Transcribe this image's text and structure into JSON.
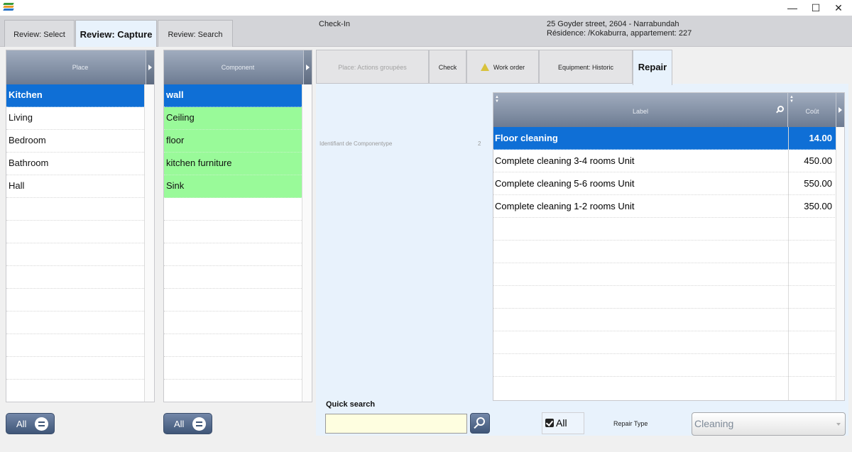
{
  "window": {
    "minimize": "—",
    "maximize": "☐",
    "close": "✕"
  },
  "header": {
    "tabs": [
      {
        "label": "Review: Select"
      },
      {
        "label": "Review: Capture"
      },
      {
        "label": "Review: Search"
      }
    ],
    "mode": "Check-In",
    "address_line1": "25 Goyder street, 2604 - Narrabundah",
    "address_line2": "Résidence: /Kokaburra, appartement: 227"
  },
  "place_panel": {
    "header": "Place",
    "items": [
      "Kitchen",
      "Living",
      "Bedroom",
      "Bathroom",
      "Hall"
    ],
    "selected_index": 0,
    "all_button": "All"
  },
  "component_panel": {
    "header": "Component",
    "items": [
      "wall",
      "Ceiling",
      "floor",
      "kitchen furniture",
      "Sink"
    ],
    "selected_index": 0,
    "all_button": "All"
  },
  "right_tabs": [
    {
      "label": "Place: Actions groupées"
    },
    {
      "label": "Check"
    },
    {
      "label": "Work order",
      "icon": "warning-icon"
    },
    {
      "label": "Equipment: Historic"
    },
    {
      "label": "Repair"
    }
  ],
  "identifier": {
    "label": "Identifiant de Componentype",
    "value": "2"
  },
  "repair_grid": {
    "col_label": "Label",
    "col_cost": "Coût",
    "rows": [
      {
        "label": "Floor cleaning",
        "cost": "14.00"
      },
      {
        "label": "Complete cleaning 3-4 rooms Unit",
        "cost": "450.00"
      },
      {
        "label": "Complete cleaning 5-6 rooms Unit",
        "cost": "550.00"
      },
      {
        "label": "Complete cleaning 1-2 rooms Unit",
        "cost": "350.00"
      }
    ],
    "selected_index": 0
  },
  "quick_search": {
    "label": "Quick search",
    "value": "",
    "placeholder": ""
  },
  "all_filter": {
    "label": "All",
    "checked": true
  },
  "repair_type": {
    "label": "Repair Type",
    "selected": "Cleaning"
  },
  "colors": {
    "selection": "#0f6fd6",
    "component_highlight": "#99fa99",
    "header_gradient_top": "#a0acbe",
    "header_gradient_bottom": "#6d7b92",
    "active_tab": "#e8f2fc"
  }
}
